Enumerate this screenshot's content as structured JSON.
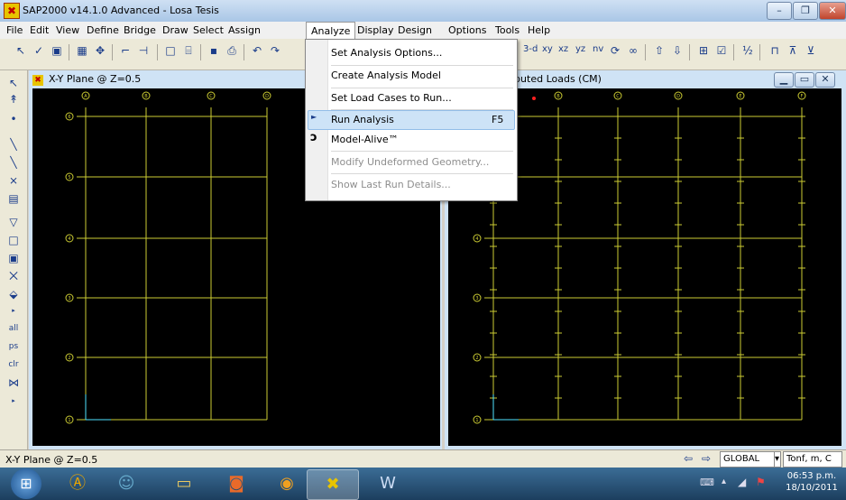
{
  "window": {
    "title": "SAP2000 v14.1.0 Advanced - Losa Tesis",
    "controls": {
      "minimize": "–",
      "maximize": "❐",
      "close": "✕"
    }
  },
  "menubar": {
    "items": [
      "File",
      "Edit",
      "View",
      "Define",
      "Bridge",
      "Draw",
      "Select",
      "Assign",
      "Analyze",
      "Display",
      "Design",
      "Options",
      "Tools",
      "Help"
    ],
    "open": "Analyze"
  },
  "toolbar": {
    "view_labels": [
      "3-d",
      "xy",
      "xz",
      "yz",
      "nv"
    ]
  },
  "analyze_menu": {
    "items": [
      {
        "label": "Set Analysis Options...",
        "shortcut": "",
        "enabled": true
      },
      {
        "label": "Create Analysis Model",
        "shortcut": "",
        "enabled": true
      },
      {
        "label": "Set Load Cases to Run...",
        "shortcut": "",
        "enabled": true
      },
      {
        "label": "Run Analysis",
        "shortcut": "F5",
        "enabled": true,
        "highlighted": true
      },
      {
        "label": "Model-Alive™",
        "shortcut": "",
        "enabled": true
      },
      {
        "label": "Modify Undeformed Geometry...",
        "shortcut": "",
        "enabled": false
      },
      {
        "label": "Show Last Run Details...",
        "shortcut": "",
        "enabled": false
      }
    ]
  },
  "left_panel": {
    "title": "X-Y Plane @ Z=0.5"
  },
  "right_panel": {
    "title": "ibuted Loads (CM)"
  },
  "left_toolbar": {
    "labels": [
      "all",
      "ps",
      "clr"
    ]
  },
  "grid": {
    "col_labels": [
      "A",
      "B",
      "C",
      "D"
    ],
    "row_labels": [
      "6",
      "5",
      "4",
      "3",
      "2",
      "1"
    ],
    "right_col_labels": [
      "B",
      "C",
      "D",
      "E",
      "F"
    ],
    "line_color": "#cccc33",
    "bubble_color": "#cccc33"
  },
  "statusbar": {
    "text": "X-Y Plane @ Z=0.5",
    "coord_system": "GLOBAL",
    "units": "Tonf, m, C"
  },
  "taskbar": {
    "time": "06:53 p.m.",
    "date": "18/10/2011"
  }
}
